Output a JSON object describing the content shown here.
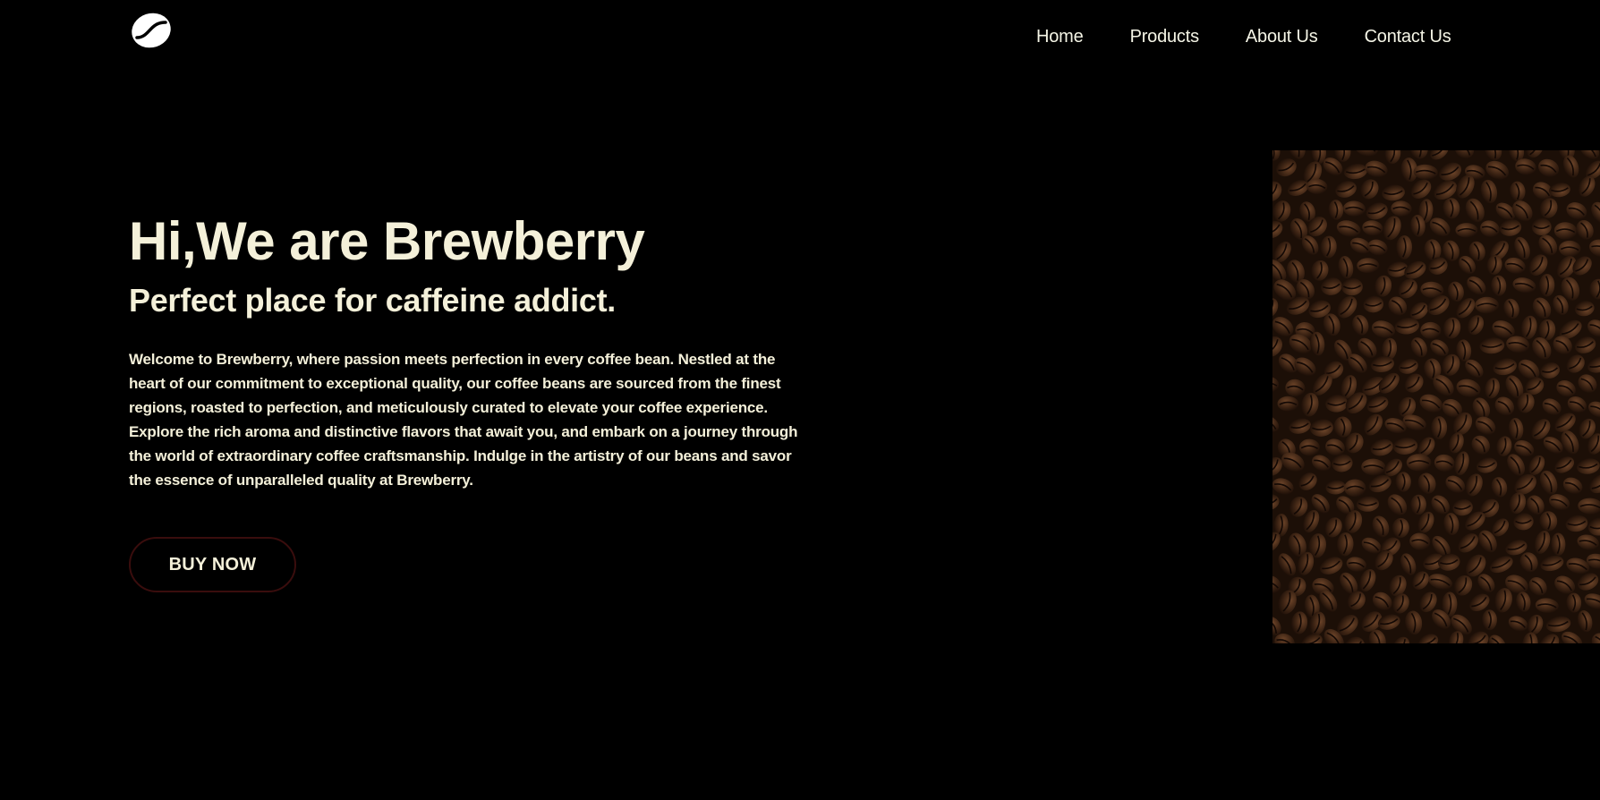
{
  "brand": {
    "logo_icon": "coffee-bean-icon"
  },
  "nav": {
    "items": [
      {
        "label": "Home"
      },
      {
        "label": "Products"
      },
      {
        "label": "About Us"
      },
      {
        "label": "Contact Us"
      }
    ]
  },
  "hero": {
    "title": "Hi,We are Brewberry",
    "subtitle": "Perfect place for caffeine addict.",
    "description": "Welcome to Brewberry, where passion meets perfection in every coffee bean. Nestled at the heart of our commitment to exceptional quality, our coffee beans are sourced from the finest regions, roasted to perfection, and meticulously curated to elevate your coffee experience. Explore the rich aroma and distinctive flavors that await you, and embark on a journey through the world of extraordinary coffee craftsmanship. Indulge in the artistry of our beans and savor the essence of unparalleled quality at Brewberry.",
    "cta_label": "BUY NOW"
  },
  "image": {
    "subject": "coffee-beans-photo"
  },
  "colors": {
    "background": "#000000",
    "text": "#f4f0d9",
    "button_border": "#3a0d0d"
  }
}
